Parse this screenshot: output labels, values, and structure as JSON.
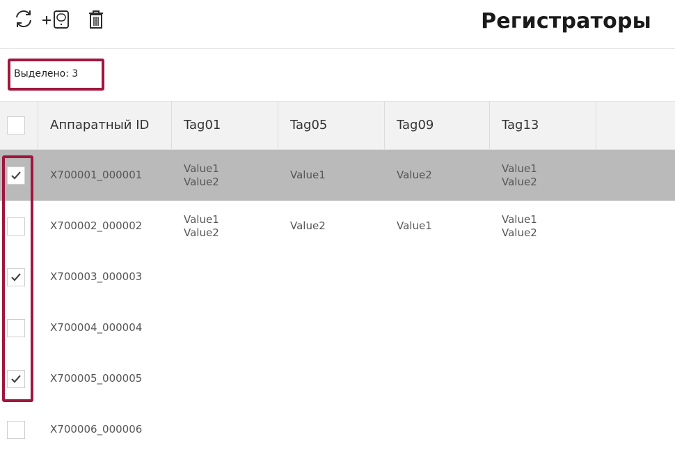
{
  "toolbar": {
    "refresh_icon": "refresh-icon",
    "add_icon": "add-device-icon",
    "delete_icon": "trash-icon"
  },
  "page": {
    "title": "Регистраторы"
  },
  "selection": {
    "count_label": "Выделено: 3"
  },
  "table": {
    "columns": [
      "Аппаратный ID",
      "Tag01",
      "Tag05",
      "Tag09",
      "Tag13",
      ""
    ],
    "rows": [
      {
        "id": "X700001_000001",
        "checked": true,
        "highlighted": true,
        "tag01": [
          "Value1",
          "Value2"
        ],
        "tag05": [
          "Value1"
        ],
        "tag09": [
          "Value2"
        ],
        "tag13": [
          "Value1",
          "Value2"
        ]
      },
      {
        "id": "X700002_000002",
        "checked": false,
        "highlighted": false,
        "tag01": [
          "Value1",
          "Value2"
        ],
        "tag05": [
          "Value2"
        ],
        "tag09": [
          "Value1"
        ],
        "tag13": [
          "Value1",
          "Value2"
        ]
      },
      {
        "id": "X700003_000003",
        "checked": true,
        "highlighted": false,
        "tag01": [],
        "tag05": [],
        "tag09": [],
        "tag13": []
      },
      {
        "id": "X700004_000004",
        "checked": false,
        "highlighted": false,
        "tag01": [],
        "tag05": [],
        "tag09": [],
        "tag13": []
      },
      {
        "id": "X700005_000005",
        "checked": true,
        "highlighted": false,
        "tag01": [],
        "tag05": [],
        "tag09": [],
        "tag13": []
      },
      {
        "id": "X700006_000006",
        "checked": false,
        "highlighted": false,
        "tag01": [],
        "tag05": [],
        "tag09": [],
        "tag13": []
      }
    ]
  },
  "colors": {
    "highlight_border": "#a0173e",
    "selected_row": "#bababa",
    "header_bg": "#f2f2f2"
  }
}
